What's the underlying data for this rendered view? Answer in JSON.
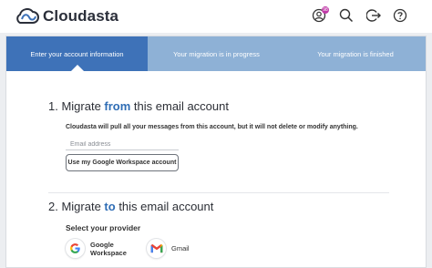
{
  "app": {
    "name": "Cloudasta"
  },
  "header": {
    "icons": [
      "account-icon",
      "search-icon",
      "logout-icon",
      "help-icon"
    ],
    "notification_count": "98"
  },
  "steps": [
    {
      "label": "Enter your account information",
      "active": true
    },
    {
      "label": "Your migration is in progress",
      "active": false
    },
    {
      "label": "Your migration is finished",
      "active": false
    }
  ],
  "source": {
    "prefix": "1. Migrate ",
    "highlight": "from",
    "suffix": " this email account",
    "note": "Cloudasta will pull all your messages from this account, but it will not delete or modify anything.",
    "email_placeholder": "Email address",
    "email_value": "",
    "gws_button_label": "Use my Google Workspace account"
  },
  "destination": {
    "prefix": "2. Migrate ",
    "highlight": "to",
    "suffix": " this email account",
    "provider_label": "Select your provider",
    "providers": [
      {
        "name_line1": "Google",
        "name_line2": "Workspace",
        "icon": "google-g-icon"
      },
      {
        "name_line1": "Gmail",
        "name_line2": "",
        "icon": "gmail-icon"
      }
    ]
  },
  "colors": {
    "accent": "#3e72b8",
    "step_inactive": "#8eb1d6",
    "highlight_text": "#2f6db5"
  }
}
